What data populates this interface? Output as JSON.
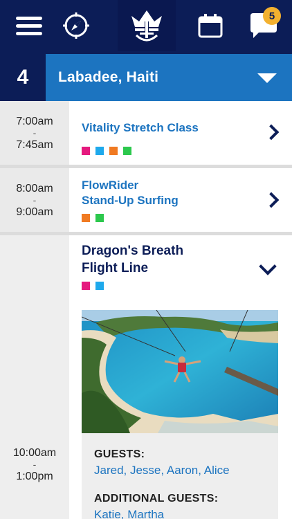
{
  "nav": {
    "icons": [
      "menu-icon",
      "compass-icon",
      "crown-anchor-logo",
      "calendar-icon",
      "chat-icon"
    ],
    "messages_badge": "5"
  },
  "day": {
    "number": "4",
    "port": "Labadee, Haiti"
  },
  "colors": {
    "navy": "#0c1d57",
    "blue": "#1c74c0",
    "pink": "#e5197e",
    "cyan": "#1ea9ec",
    "orange": "#f07a22",
    "green": "#2cc84d"
  },
  "activities": [
    {
      "start": "7:00am",
      "sep": "-",
      "end": "7:45am",
      "title": "Vitality Stretch Class",
      "swatches": [
        "#e5197e",
        "#1ea9ec",
        "#f07a22",
        "#2cc84d"
      ]
    },
    {
      "start": "8:00am",
      "sep": "-",
      "end": "9:00am",
      "title_line1": "FlowRider",
      "title_line2": "Stand-Up Surfing",
      "swatches": [
        "#f07a22",
        "#2cc84d"
      ]
    },
    {
      "start": "10:00am",
      "sep": "-",
      "end": "1:00pm",
      "title_line1": "Dragon's Breath",
      "title_line2": "Flight Line",
      "swatches": [
        "#e5197e",
        "#1ea9ec"
      ],
      "guests_label": "GUESTS:",
      "guests": "Jared, Jesse, Aaron, Alice",
      "additional_label": "ADDITIONAL GUESTS:",
      "additional": "Katie, Martha"
    }
  ]
}
